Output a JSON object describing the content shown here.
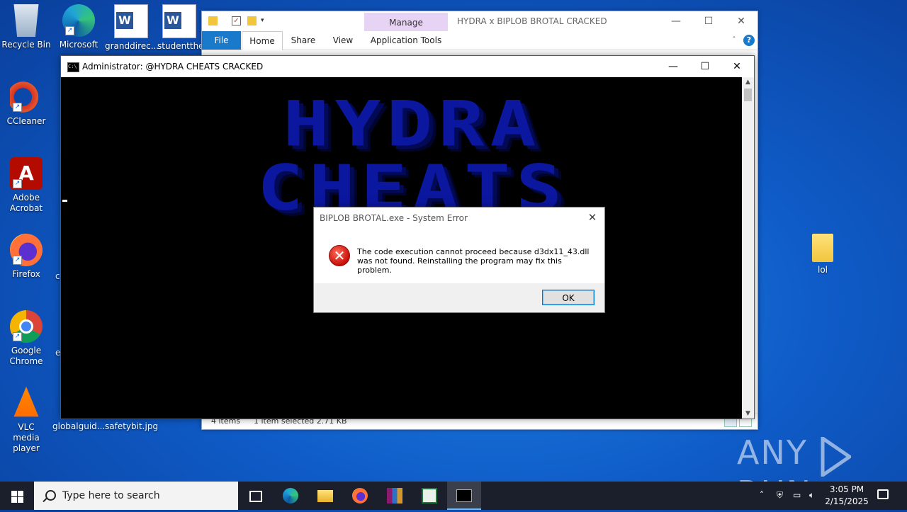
{
  "desktop": {
    "icons": [
      {
        "label": "Recycle Bin"
      },
      {
        "label": "Microsoft Edge"
      },
      {
        "label": "granddirec..."
      },
      {
        "label": "studentthe..."
      },
      {
        "label": "CCleaner"
      },
      {
        "label": "Adobe Acrobat"
      },
      {
        "label": "Firefox"
      },
      {
        "label": "Google Chrome"
      },
      {
        "label": "VLC media player"
      },
      {
        "label": "globalguid..."
      },
      {
        "label": "safetybit.jpg"
      },
      {
        "label": "lol"
      }
    ],
    "partial_labels": [
      "c",
      "e"
    ]
  },
  "explorer": {
    "title": "HYDRA x BIPLOB BROTAL CRACKED",
    "manage_tab": "Manage",
    "tabs": [
      "File",
      "Home",
      "Share",
      "View",
      "Application Tools"
    ],
    "status": {
      "items": "4 items",
      "selected": "1 item selected  2.71 KB"
    }
  },
  "cmd": {
    "title": "Administrator:  @HYDRA CHEATS CRACKED",
    "banner": "HYDRA CHEATS"
  },
  "dialog": {
    "title": "BIPLOB BROTAL.exe - System Error",
    "message": "The code execution cannot proceed because d3dx11_43.dll was not found. Reinstalling the program may fix this problem.",
    "ok_label": "OK"
  },
  "taskbar": {
    "search_placeholder": "Type here to search",
    "time": "3:05 PM",
    "date": "2/15/2025"
  },
  "watermark": {
    "left": "ANY",
    "right": "RUN"
  },
  "colors": {
    "banner": "#0c17a0",
    "file_tab": "#1979ca",
    "manage_tab": "#e7d4f4",
    "taskbar": "#1a1f2b"
  }
}
